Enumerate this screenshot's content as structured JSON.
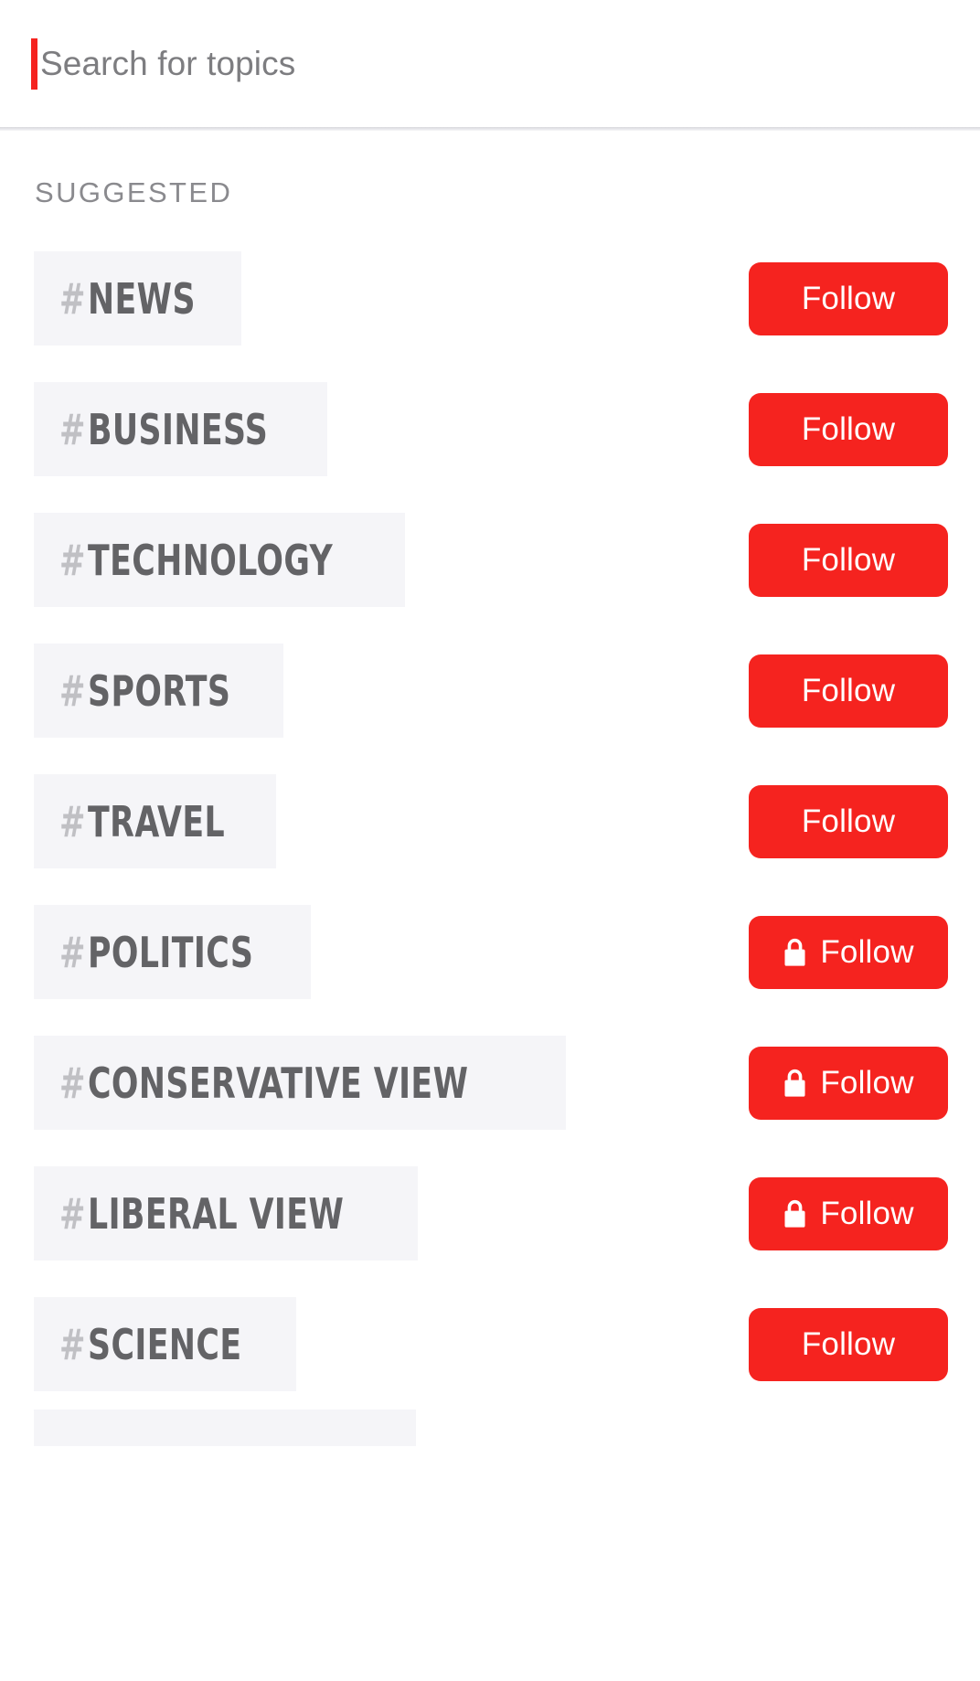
{
  "search": {
    "placeholder": "Search for topics",
    "value": "",
    "caret_color": "#f5231f"
  },
  "section": {
    "header": "SUGGESTED"
  },
  "colors": {
    "accent_red": "#f5231f",
    "chip_bg": "#f5f5f8",
    "chip_text": "#636366",
    "hash_text": "#c0c0c4",
    "placeholder_text": "#7d7d80",
    "section_header_text": "#8a8a8e"
  },
  "follow_button": {
    "label": "Follow",
    "lock_icon_name": "lock-icon"
  },
  "topics": [
    {
      "hash": "#",
      "name": "NEWS",
      "follow_label": "Follow",
      "locked": false
    },
    {
      "hash": "#",
      "name": "BUSINESS",
      "follow_label": "Follow",
      "locked": false
    },
    {
      "hash": "#",
      "name": "TECHNOLOGY",
      "follow_label": "Follow",
      "locked": false
    },
    {
      "hash": "#",
      "name": "SPORTS",
      "follow_label": "Follow",
      "locked": false
    },
    {
      "hash": "#",
      "name": "TRAVEL",
      "follow_label": "Follow",
      "locked": false
    },
    {
      "hash": "#",
      "name": "POLITICS",
      "follow_label": "Follow",
      "locked": true
    },
    {
      "hash": "#",
      "name": "CONSERVATIVE VIEW",
      "follow_label": "Follow",
      "locked": true
    },
    {
      "hash": "#",
      "name": "LIBERAL VIEW",
      "follow_label": "Follow",
      "locked": true
    },
    {
      "hash": "#",
      "name": "SCIENCE",
      "follow_label": "Follow",
      "locked": false
    }
  ]
}
